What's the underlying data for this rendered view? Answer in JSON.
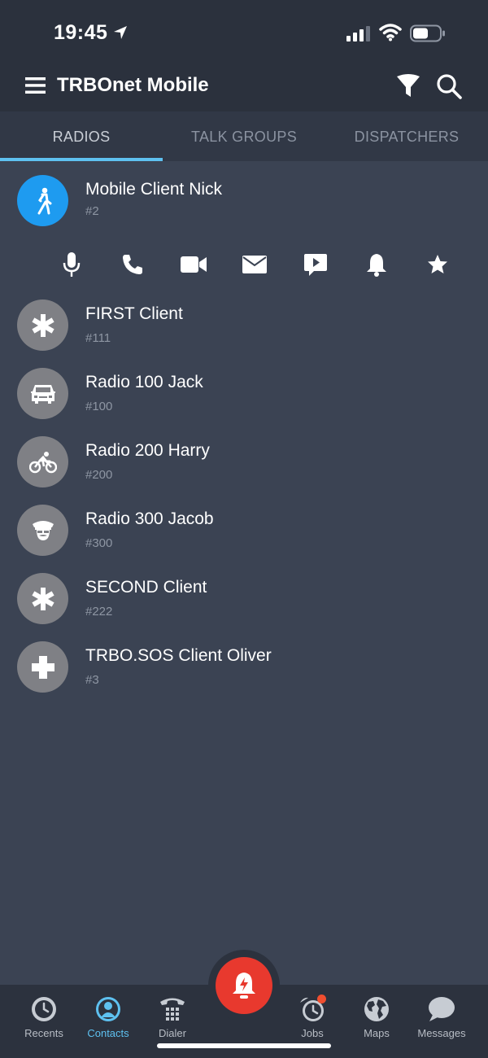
{
  "status_bar": {
    "time": "19:45"
  },
  "header": {
    "title": "TRBOnet Mobile",
    "filter_icon": "filter-icon",
    "search_icon": "search-icon",
    "menu_icon": "menu-icon"
  },
  "tabs": [
    {
      "label": "RADIOS",
      "active": true
    },
    {
      "label": "TALK GROUPS",
      "active": false
    },
    {
      "label": "DISPATCHERS",
      "active": false
    }
  ],
  "contacts": [
    {
      "name": "Mobile Client Nick",
      "number": "#2",
      "icon": "walking-person-icon",
      "color": "#1e9bf0",
      "selected": true
    },
    {
      "name": "FIRST Client",
      "number": "#111",
      "icon": "asterisk-icon"
    },
    {
      "name": "Radio 100 Jack",
      "number": "#100",
      "icon": "car-icon"
    },
    {
      "name": "Radio 200 Harry",
      "number": "#200",
      "icon": "cyclist-icon"
    },
    {
      "name": "Radio 300 Jacob",
      "number": "#300",
      "icon": "police-officer-icon"
    },
    {
      "name": "SECOND Client",
      "number": "#222",
      "icon": "asterisk-icon"
    },
    {
      "name": "TRBO.SOS Client Oliver",
      "number": "#3",
      "icon": "plus-cross-icon"
    }
  ],
  "contact_actions": [
    "microphone-icon",
    "phone-icon",
    "video-camera-icon",
    "envelope-icon",
    "message-play-icon",
    "bell-icon",
    "star-icon"
  ],
  "bottom_nav": [
    {
      "label": "Recents",
      "icon": "history-clock-icon"
    },
    {
      "label": "Contacts",
      "icon": "contact-person-icon",
      "active": true
    },
    {
      "label": "Dialer",
      "icon": "telephone-keypad-icon"
    },
    {
      "label": "Jobs",
      "icon": "alarm-clock-icon"
    },
    {
      "label": "Maps",
      "icon": "globe-icon"
    },
    {
      "label": "Messages",
      "icon": "chat-bubble-icon"
    }
  ],
  "alarm_button": {
    "icon": "alarm-bell-icon"
  },
  "colors": {
    "accent": "#5ec1f0",
    "background": "#3b4353",
    "header": "#2b313d",
    "alarm": "#e8392e"
  }
}
